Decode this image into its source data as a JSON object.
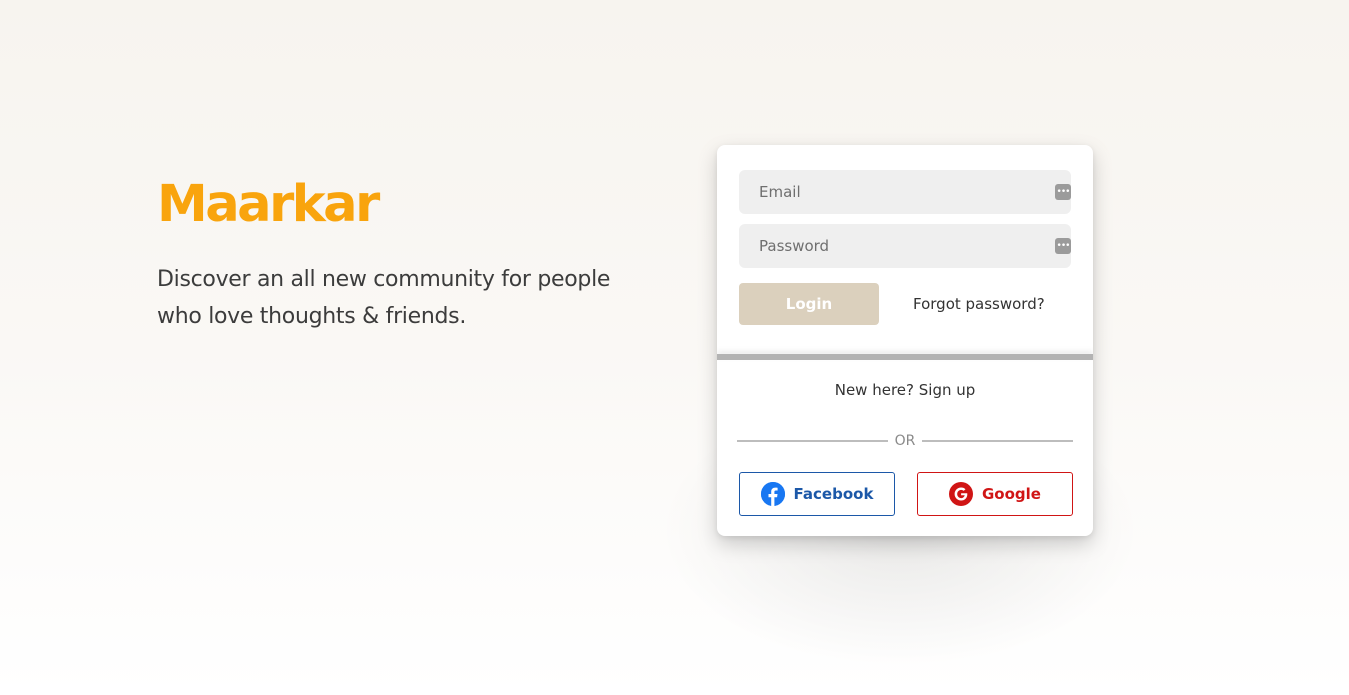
{
  "brand": {
    "name": "Maarkar",
    "tagline": "Discover an all new community for people\nwho love thoughts & friends.",
    "color": "#f9a40d"
  },
  "login_form": {
    "email_placeholder": "Email",
    "password_placeholder": "Password",
    "login_label": "Login",
    "forgot_label": "Forgot password?",
    "field_icon": "password-manager-icon"
  },
  "signup": {
    "prompt": "New here?",
    "link_label": "Sign up"
  },
  "divider": {
    "label": "OR"
  },
  "social": {
    "facebook_label": "Facebook",
    "facebook_icon": "facebook-icon",
    "facebook_color": "#1c58a8",
    "google_label": "Google",
    "google_icon": "google-icon",
    "google_color": "#d01515"
  }
}
